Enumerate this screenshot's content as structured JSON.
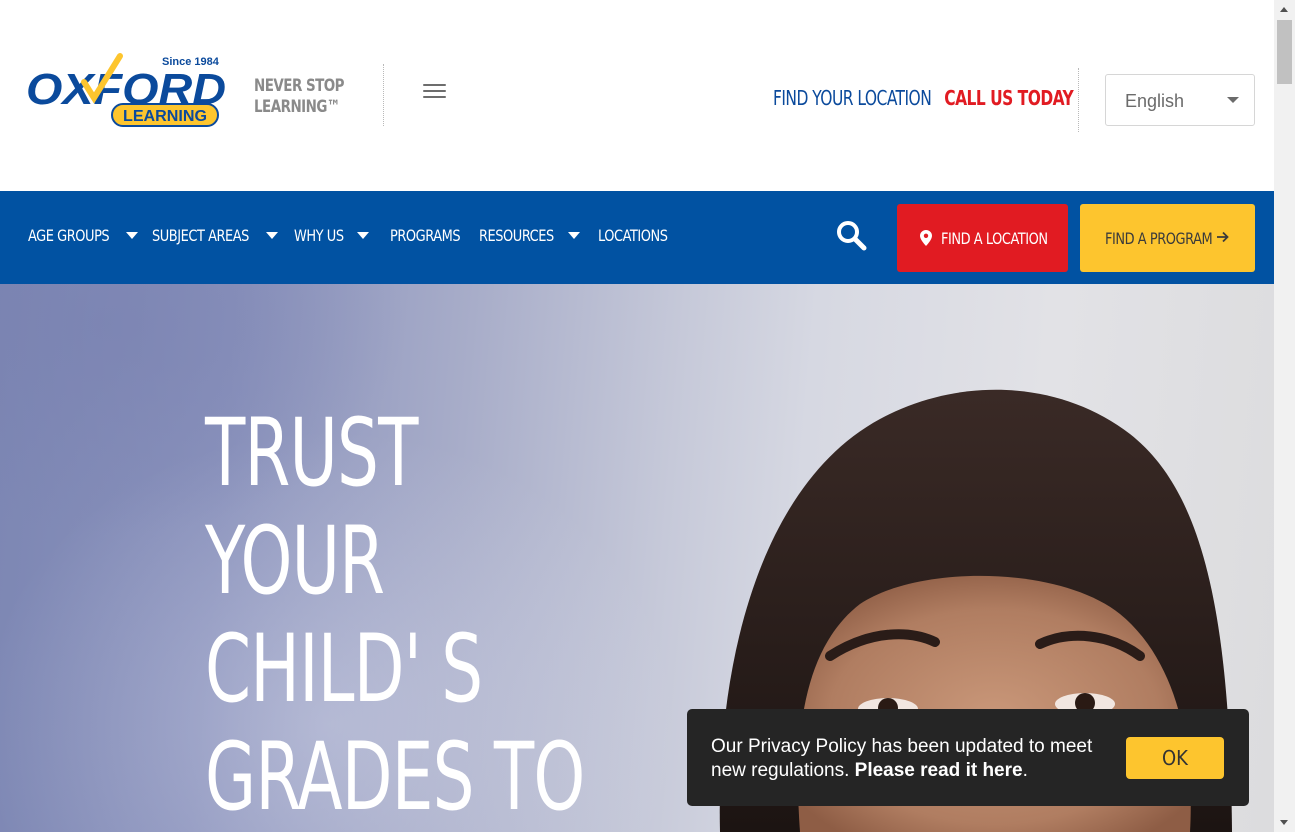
{
  "brand": {
    "logo_top": "Since 1984",
    "logo_main": "OXFORD",
    "logo_sub": "LEARNING",
    "tagline_line1": "NEVER STOP",
    "tagline_line2": "LEARNING™",
    "colors": {
      "blue": "#0152a2",
      "red": "#e11b22",
      "yellow": "#fdc52e"
    }
  },
  "header": {
    "find_location": "FIND YOUR LOCATION",
    "call_us": "CALL US TODAY",
    "language": "English",
    "menu_icon": "hamburger-icon"
  },
  "nav": {
    "items": [
      {
        "label": "AGE GROUPS",
        "dropdown": true
      },
      {
        "label": "SUBJECT AREAS",
        "dropdown": true
      },
      {
        "label": "WHY US",
        "dropdown": true
      },
      {
        "label": "PROGRAMS",
        "dropdown": false
      },
      {
        "label": "RESOURCES",
        "dropdown": true
      },
      {
        "label": "LOCATIONS",
        "dropdown": false
      }
    ],
    "search_icon": "search-icon",
    "find_location_button": "FIND A LOCATION",
    "find_program_button": "FIND A PROGRAM"
  },
  "hero": {
    "lines": [
      "TRUST",
      "YOUR",
      "CHILD' S",
      "GRADES TO"
    ]
  },
  "cookie": {
    "message": "Our Privacy Policy has been updated to meet new regulations.",
    "link": "Please read it here",
    "ok": "OK"
  }
}
